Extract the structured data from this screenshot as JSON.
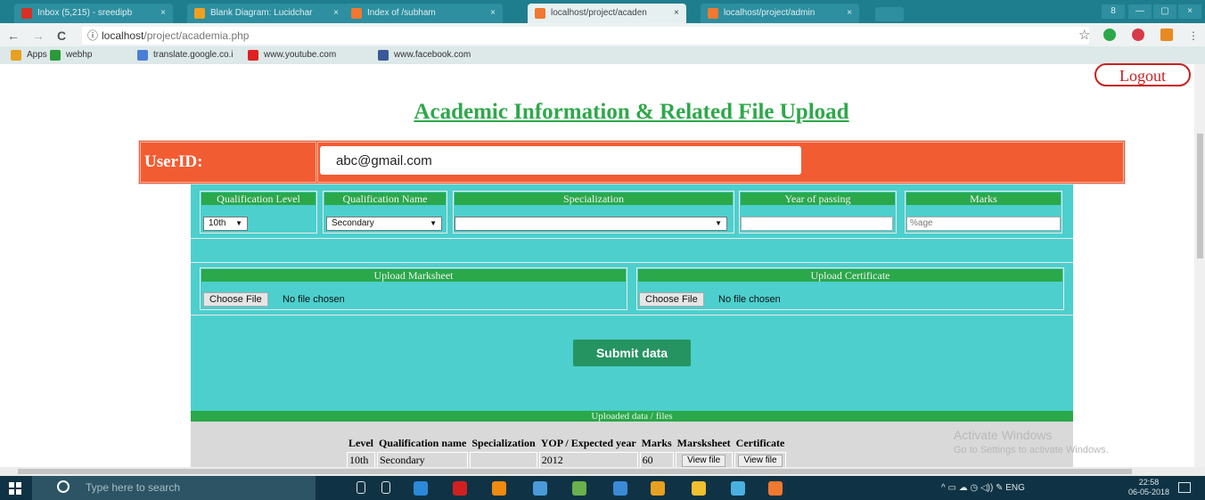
{
  "browser": {
    "tabs": [
      {
        "title": "Inbox (5,215) - sreedipb",
        "icon_color": "#d93025",
        "active": false
      },
      {
        "title": "Blank Diagram: Lucidchar",
        "icon_color": "#f0a020",
        "active": false
      },
      {
        "title": "Index of /subham",
        "icon_color": "#f07830",
        "active": false
      },
      {
        "title": "localhost/project/acaden",
        "icon_color": "#f07830",
        "active": true
      },
      {
        "title": "localhost/project/admin",
        "icon_color": "#f07830",
        "active": false
      }
    ],
    "tab_close": "×",
    "window_controls": {
      "user": "8",
      "minimize": "—",
      "maximize": "▢",
      "close": "×"
    },
    "nav": {
      "back": "←",
      "forward": "→",
      "reload": "C"
    },
    "address": {
      "info_icon": "ⓘ",
      "host": "localhost",
      "path": "/project/academia.php"
    },
    "star": "☆",
    "bookmarks": [
      {
        "label": "Apps",
        "icon": "apps-icon",
        "color": "#e8a020"
      },
      {
        "label": "webhp",
        "icon": "google-icon",
        "color": "#2a9a3a"
      },
      {
        "label": "translate.google.co.i",
        "icon": "translate-icon",
        "color": "#4a7fd8"
      },
      {
        "label": "www.youtube.com",
        "icon": "youtube-icon",
        "color": "#e02020"
      },
      {
        "label": "www.facebook.com",
        "icon": "facebook-icon",
        "color": "#3b5998"
      }
    ]
  },
  "page": {
    "logout_label": "Logout",
    "title": "Academic Information & Related File Upload",
    "user_label": "UserID:",
    "user_value": "abc@gmail.com",
    "form": {
      "qualification_level_label": "Qualification Level",
      "qualification_level_value": "10th",
      "qualification_name_label": "Qualification Name",
      "qualification_name_value": "Secondary",
      "specialization_label": "Specialization",
      "specialization_value": "",
      "year_label": "Year of passing",
      "year_value": "",
      "marks_label": "Marks",
      "marks_placeholder": "%age",
      "upload_marksheet_label": "Upload Marksheet",
      "upload_certificate_label": "Upload Certificate",
      "choose_file_label": "Choose File",
      "no_file_label": "No file chosen",
      "submit_label": "Submit data"
    },
    "uploaded": {
      "header": "Uploaded data / files",
      "columns": [
        "Level",
        "Qualification name",
        "Specialization",
        "YOP / Expected year",
        "Marks",
        "Marsksheet",
        "Certificate"
      ],
      "rows": [
        {
          "level": "10th",
          "qualification": "Secondary",
          "specialization": "",
          "yop": "2012",
          "marks": "60",
          "marksheet": "View file",
          "certificate": "View file"
        }
      ]
    },
    "watermark": {
      "line1": "Activate Windows",
      "line2": "Go to Settings to activate Windows."
    }
  },
  "taskbar": {
    "search_placeholder": "Type here to search",
    "apps": [
      {
        "icon": "microphone-icon",
        "color": "#dce6ea"
      },
      {
        "icon": "task-view-icon",
        "color": "#dce6ea"
      },
      {
        "icon": "edge-icon",
        "color": "#2a8ad8"
      },
      {
        "icon": "acrobat-icon",
        "color": "#d02020"
      },
      {
        "icon": "vlc-icon",
        "color": "#f08a10"
      },
      {
        "icon": "chrome-icon",
        "color": "#4a9ad8"
      },
      {
        "icon": "photos-icon",
        "color": "#6ab04c"
      },
      {
        "icon": "sway-icon",
        "color": "#3a8ad8"
      },
      {
        "icon": "chrome-taskbar-icon",
        "color": "#e8a020"
      },
      {
        "icon": "file-explorer-icon",
        "color": "#f0c030"
      },
      {
        "icon": "store-icon",
        "color": "#4ab0e0"
      },
      {
        "icon": "xampp-icon",
        "color": "#f07830"
      }
    ],
    "tray": "^  ▭  ☁  ◷  ◁))  ✎  ENG",
    "time": "22:58",
    "date": "06-05-2018"
  }
}
